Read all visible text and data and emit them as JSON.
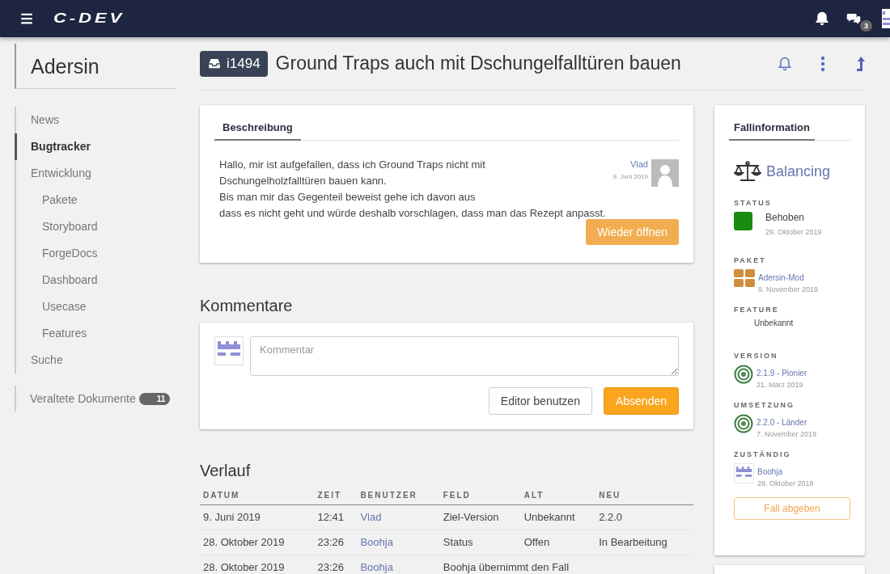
{
  "topbar": {
    "logo": "C-DEV",
    "chat_count": "3"
  },
  "sidebar": {
    "title": "Adersin",
    "items": [
      {
        "label": "News",
        "selected": false
      },
      {
        "label": "Bugtracker",
        "selected": true
      },
      {
        "label": "Entwicklung",
        "selected": false,
        "children": [
          {
            "label": "Pakete",
            "selected": false
          },
          {
            "label": "Storyboard",
            "selected": false
          },
          {
            "label": "ForgeDocs",
            "selected": false
          },
          {
            "label": "Dashboard",
            "selected": false
          },
          {
            "label": "Usecase",
            "selected": false
          },
          {
            "label": "Features",
            "selected": false
          }
        ]
      },
      {
        "label": "Suche",
        "selected": false
      }
    ],
    "extra": {
      "label": "Veraltete Dokumente",
      "count": "11"
    }
  },
  "issue": {
    "id": "i1494",
    "title": "Ground Traps auch mit Dschungelfalltüren bauen"
  },
  "description": {
    "tab": "Beschreibung",
    "lines": [
      "Hallo, mir ist aufgefallen, dass ich Ground Traps nicht mit",
      "Dschungelholzfalltüren bauen kann.",
      "Bis man mir das Gegenteil beweist gehe ich davon aus",
      "dass es nicht geht und würde deshalb vorschlagen, dass man das Rezept anpasst."
    ],
    "author": "Vlad",
    "date": "9. Juni 2019",
    "button": "Wieder öffnen"
  },
  "comments": {
    "heading": "Kommentare",
    "placeholder": "Kommentar",
    "buttons": [
      "Editor benutzen",
      "Absenden"
    ]
  },
  "history": {
    "heading": "Verlauf",
    "columns": [
      "DATUM",
      "ZEIT",
      "BENUTZER",
      "FELD",
      "ALT",
      "NEU"
    ],
    "rows": [
      {
        "kind": "change",
        "date": "9. Juni 2019",
        "time": "12:41",
        "user": "Vlad",
        "field": "Ziel-Version",
        "old": "Unbekannt",
        "new": "2.2.0"
      },
      {
        "kind": "change",
        "date": "28. Oktober 2019",
        "time": "23:26",
        "user": "Boohja",
        "field": "Status",
        "old": "Offen",
        "new": "In Bearbeitung"
      },
      {
        "kind": "note",
        "date": "28. Oktober 2019",
        "time": "23:26",
        "user": "Boohja",
        "note": "Boohja übernimmt den Fall"
      }
    ]
  },
  "info": {
    "tab": "Fallinformation",
    "category": "Balancing",
    "sections": [
      {
        "label": "STATUS",
        "kind": "status",
        "color": "#178c0e",
        "value": "Behoben",
        "date": "29. Oktober 2019"
      },
      {
        "label": "PAKET",
        "kind": "package",
        "value": "Adersin-Mod",
        "date": "9. November 2019"
      },
      {
        "label": "FEATURE",
        "kind": "plain",
        "value": "Unbekannt"
      },
      {
        "label": "VERSION",
        "kind": "version",
        "value": "2.1.9 - Pionier",
        "date": "21. März 2019"
      },
      {
        "label": "UMSETZUNG",
        "kind": "version",
        "value": "2.2.0 - Länder",
        "date": "7. November 2019"
      },
      {
        "label": "ZUSTÄNDIG",
        "kind": "user",
        "value": "Boohja",
        "date": "28. Oktober 2019"
      }
    ],
    "button": "Fall abgeben"
  }
}
